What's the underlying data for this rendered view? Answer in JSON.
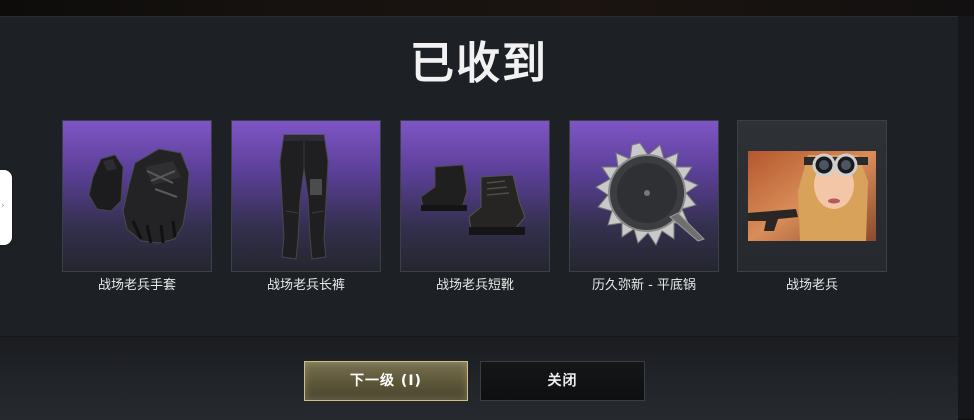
{
  "dialog": {
    "title": "已收到"
  },
  "items": [
    {
      "label": "战场老兵手套",
      "icon": "gloves-icon"
    },
    {
      "label": "战场老兵长裤",
      "icon": "pants-icon"
    },
    {
      "label": "战场老兵短靴",
      "icon": "boots-icon"
    },
    {
      "label": "历久弥新 - 平底锅",
      "icon": "sawblade-pan-icon"
    },
    {
      "label": "战场老兵",
      "icon": "character-portrait"
    }
  ],
  "buttons": {
    "next_label": "下一级 (I)",
    "close_label": "关闭"
  },
  "side_tab": {
    "glyph": "›"
  },
  "colors": {
    "rarity_gradient_top": "#7e55c5",
    "dialog_bg": "#1d2025",
    "next_button_border": "#c9bf87"
  }
}
